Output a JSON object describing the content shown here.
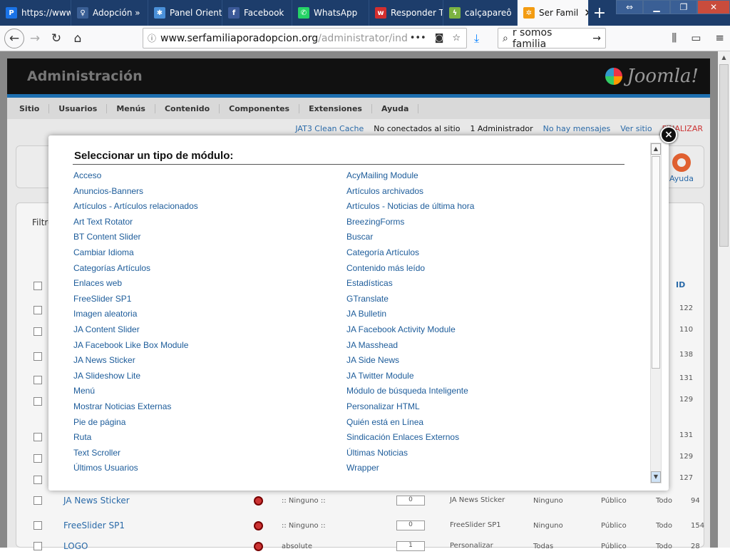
{
  "browser": {
    "tabs": [
      {
        "label": "https://www",
        "icon": "pin-icon",
        "color": "#1a73e8",
        "glyph": "P"
      },
      {
        "label": "Adopción »",
        "icon": "figure-icon",
        "color": "#3a5f95",
        "glyph": "♀"
      },
      {
        "label": "Panel Orient",
        "icon": "puzzle-icon",
        "color": "#4a90d9",
        "glyph": "✱"
      },
      {
        "label": "Facebook",
        "icon": "facebook-icon",
        "color": "#3b5998",
        "glyph": "f"
      },
      {
        "label": "WhatsApp",
        "icon": "whatsapp-icon",
        "color": "#25d366",
        "glyph": "✆"
      },
      {
        "label": "Responder T",
        "icon": "wattpad-icon",
        "color": "#d32f2f",
        "glyph": "w"
      },
      {
        "label": "calçapareô",
        "icon": "bolt-icon",
        "color": "#7cb342",
        "glyph": "ϟ"
      },
      {
        "label": "Ser Famil",
        "icon": "joomla-icon",
        "color": "#f39c12",
        "glyph": "✲"
      }
    ],
    "new_tab_label": "+",
    "url_host": "www.serfamiliaporadopcion.org",
    "url_rest": "/administrator/ind",
    "search_value": "r somos familia"
  },
  "joomla": {
    "admin_title": "Administración",
    "logo_text": "Joomla!",
    "menu": [
      "Sitio",
      "Usuarios",
      "Menús",
      "Contenido",
      "Componentes",
      "Extensiones",
      "Ayuda"
    ],
    "status": {
      "cache": "JAT3 Clean Cache",
      "not_connected": "No conectados al sitio",
      "admins": "1 Administrador",
      "messages": "No hay mensajes",
      "view_site": "Ver sitio",
      "logout": "FINALIZAR"
    },
    "help_label": "Ayuda",
    "filter_label": "Filtro",
    "id_header": "ID",
    "background_ids": [
      "122",
      "110",
      "138",
      "131",
      "129",
      "131",
      "129",
      "127"
    ],
    "rows": [
      {
        "title": "JA News Sticker",
        "pos": ":: Ninguno ::",
        "order": "0",
        "module": "JA News Sticker",
        "pages": "Ninguno",
        "access": "Público",
        "users": "Todo",
        "id": "94"
      },
      {
        "title": "FreeSlider SP1",
        "pos": ":: Ninguno ::",
        "order": "0",
        "module": "FreeSlider SP1",
        "pages": "Ninguno",
        "access": "Público",
        "users": "Todo",
        "id": "154"
      },
      {
        "title": "LOGO",
        "pos": "absolute",
        "order": "1",
        "module": "Personalizar",
        "pages": "Todas",
        "access": "Público",
        "users": "Todo",
        "id": "28"
      }
    ]
  },
  "modal": {
    "title": "Seleccionar un tipo de módulo:",
    "close_label": "×",
    "left_options": [
      "Acceso",
      "Anuncios-Banners",
      "Artículos - Artículos relacionados",
      "Art Text Rotator",
      "BT Content Slider",
      "Cambiar Idioma",
      "Categorías Artículos",
      "Enlaces web",
      "FreeSlider SP1",
      "Imagen aleatoria",
      "JA Content Slider",
      "JA Facebook Like Box Module",
      "JA News Sticker",
      "JA Slideshow Lite",
      "Menú",
      "Mostrar Noticias Externas",
      "Pie de página",
      "Ruta",
      "Text Scroller",
      "Últimos Usuarios"
    ],
    "right_options": [
      "AcyMailing Module",
      "Artículos archivados",
      "Artículos - Noticias de última hora",
      "BreezingForms",
      "Buscar",
      "Categoría Artículos",
      "Contenido más leído",
      "Estadísticas",
      "GTranslate",
      "JA Bulletin",
      "JA Facebook Activity Module",
      "JA Masshead",
      "JA Side News",
      "JA Twitter Module",
      "Módulo de búsqueda Inteligente",
      "Personalizar HTML",
      "Quién está en Línea",
      "Sindicación Enlaces Externos",
      "Últimas Noticias",
      "Wrapper"
    ]
  }
}
